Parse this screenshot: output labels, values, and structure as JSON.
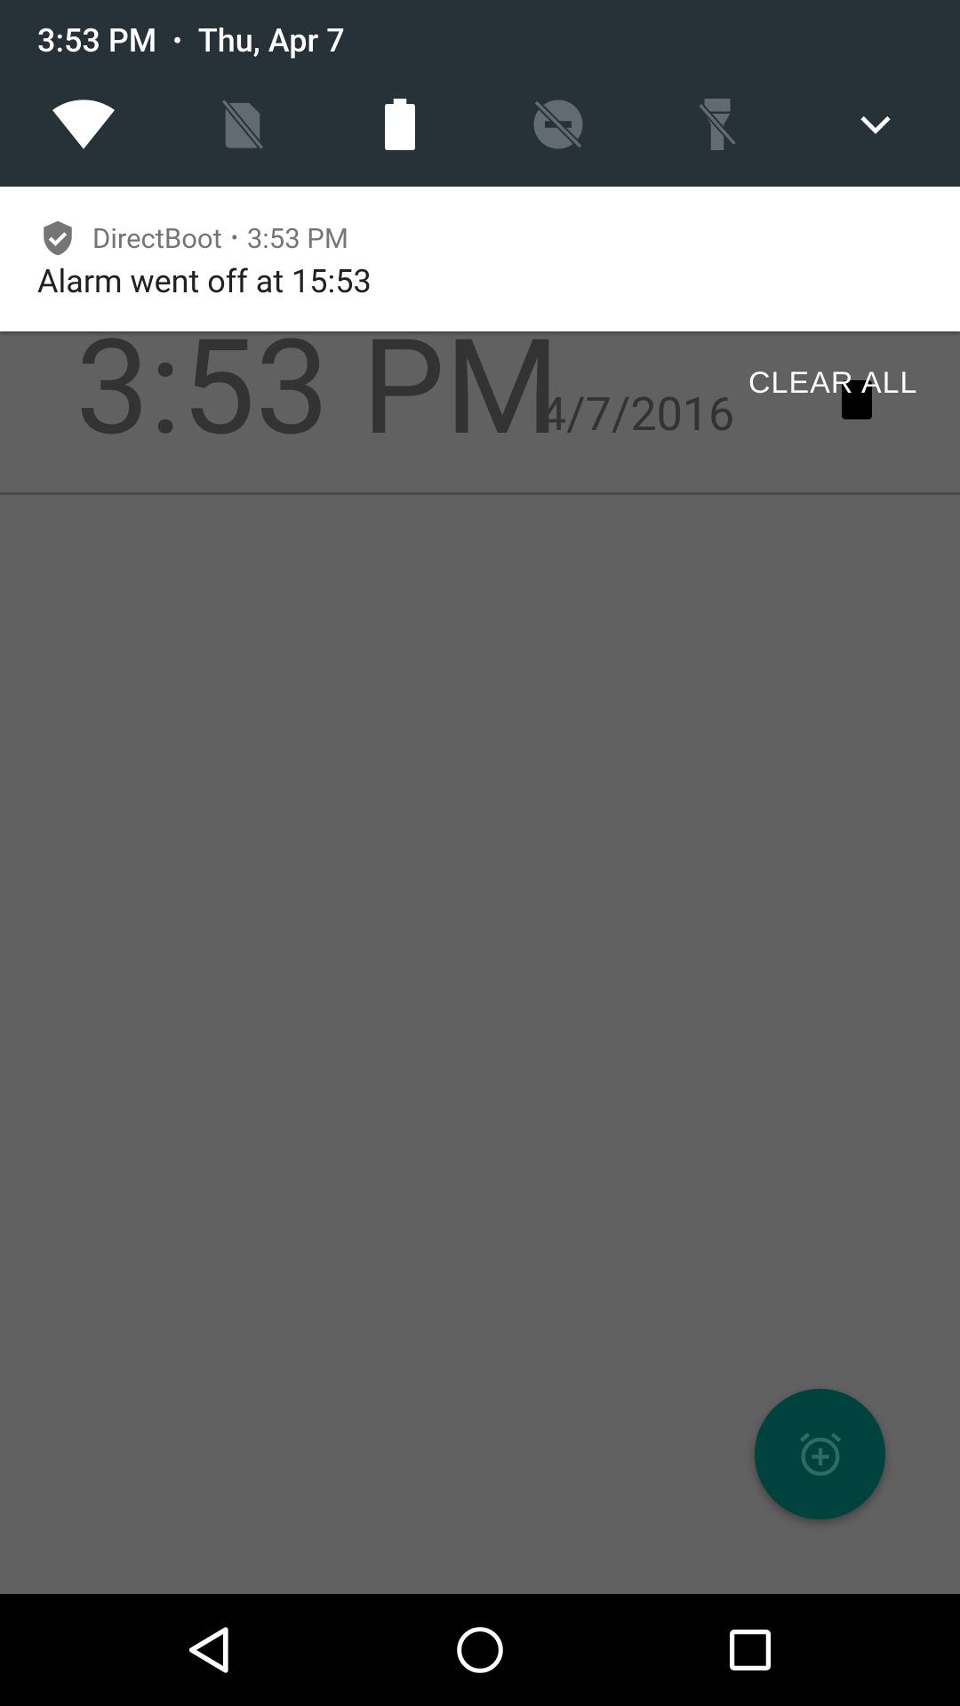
{
  "status": {
    "time": "3:53 PM",
    "date": "Thu, Apr 7"
  },
  "quick_settings": {
    "tiles": [
      "wifi-icon",
      "no-sim-icon",
      "battery-icon",
      "do-not-disturb-off-icon",
      "flashlight-off-icon",
      "expand-chevron-icon"
    ]
  },
  "notification": {
    "app_name": "DirectBoot",
    "time": "3:53 PM",
    "text": "Alarm went off at 15:53",
    "icon": "shield-check-icon"
  },
  "background_app": {
    "clock": "3:53 PM",
    "date": "4/7/2016"
  },
  "actions": {
    "clear_all": "CLEAR ALL",
    "fab_icon": "add-alarm-icon"
  },
  "navbar": {
    "buttons": [
      "back-icon",
      "home-icon",
      "recents-icon"
    ]
  },
  "colors": {
    "header_bg": "#263238",
    "scrim": "#616161",
    "fab": "#00423d"
  }
}
